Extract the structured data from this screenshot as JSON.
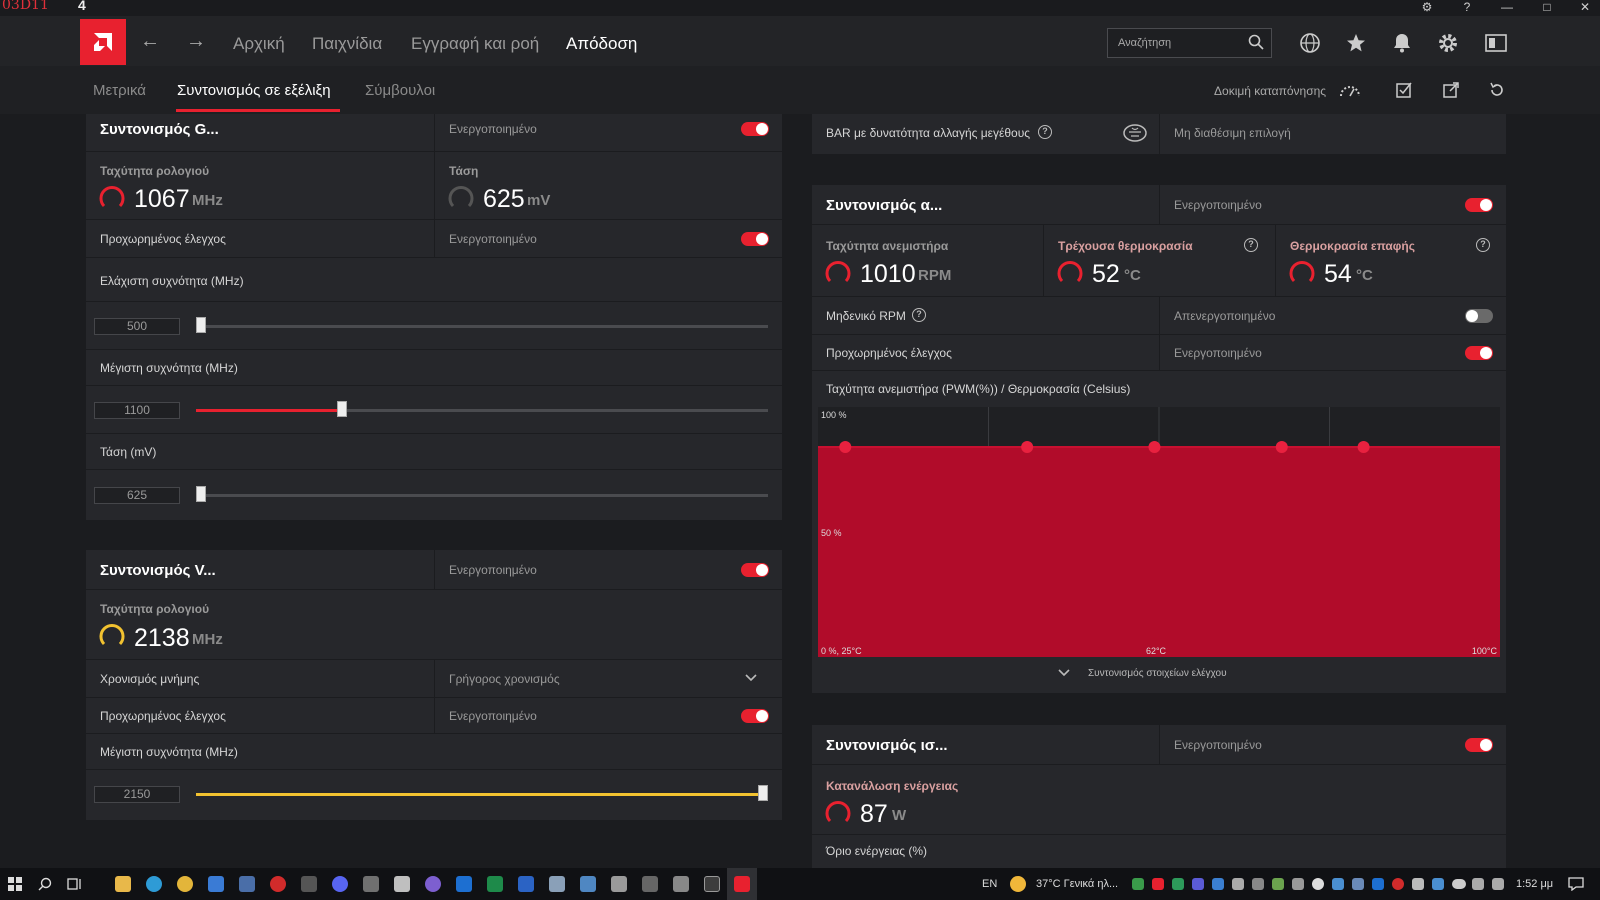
{
  "titlebar": {
    "left_text": "03D11",
    "left_text2": "4"
  },
  "nav": {
    "items": [
      "Αρχική",
      "Παιχνίδια",
      "Εγγραφή και ροή",
      "Απόδοση"
    ],
    "search_placeholder": "Αναζήτηση"
  },
  "subnav": {
    "items": [
      "Μετρικά",
      "Συντονισμός σε εξέλιξη",
      "Σύμβουλοι"
    ],
    "stress_test": "Δοκιμή καταπόνησης"
  },
  "gpu_panel": {
    "title": "Συντονισμός G...",
    "enabled": "Ενεργοποιημένο",
    "clock_label": "Ταχύτητα ρολογιού",
    "clock_value": "1067",
    "clock_unit": "MHz",
    "voltage_label": "Τάση",
    "voltage_value": "625",
    "voltage_unit": "mV",
    "advanced_label": "Προχωρημένος έλεγχος",
    "advanced_value": "Ενεργοποιημένο",
    "min_freq_label": "Ελάχιστη συχνότητα (MHz)",
    "min_freq_value": "500",
    "min_freq_level": 0.0,
    "max_freq_label": "Μέγιστη συχνότητα (MHz)",
    "max_freq_value": "1100",
    "max_freq_level": 0.25,
    "voltage_slider_label": "Τάση (mV)",
    "voltage_slider_value": "625",
    "voltage_level": 0.0
  },
  "vram_panel": {
    "title": "Συντονισμός V...",
    "enabled": "Ενεργοποιημένο",
    "clock_label": "Ταχύτητα ρολογιού",
    "clock_value": "2138",
    "clock_unit": "MHz",
    "timing_label": "Χρονισμός μνήμης",
    "timing_value": "Γρήγορος χρονισμός",
    "advanced_label": "Προχωρημένος έλεγχος",
    "advanced_value": "Ενεργοποιημένο",
    "max_freq_label": "Μέγιστη συχνότητα (MHz)",
    "max_freq_value": "2150",
    "max_freq_level": 1.0
  },
  "bar_panel": {
    "label": "BAR με δυνατότητα αλλαγής μεγέθους",
    "value": "Μη διαθέσιμη επιλογή"
  },
  "fan_panel": {
    "title": "Συντονισμός α...",
    "enabled": "Ενεργοποιημένο",
    "fan_speed_label": "Ταχύτητα ανεμιστήρα",
    "fan_speed_value": "1010",
    "fan_speed_unit": "RPM",
    "temp_label": "Τρέχουσα θερμοκρασία",
    "temp_value": "52",
    "temp_unit": "°C",
    "junction_label": "Θερμοκρασία επαφής",
    "junction_value": "54",
    "junction_unit": "°C",
    "zero_rpm_label": "Μηδενικό RPM",
    "zero_rpm_value": "Απενεργοποιημένο",
    "advanced_label": "Προχωρημένος έλεγχος",
    "advanced_value": "Ενεργοποιημένο",
    "curve_title": "Ταχύτητα ανεμιστήρα (PWM(%)) / Θερμοκρασία (Celsius)",
    "tune_controls": "Συντονισμός στοιχείων ελέγχου"
  },
  "chart_data": {
    "type": "area",
    "title": "Ταχύτητα ανεμιστήρα (PWM(%)) / Θερμοκρασία (Celsius)",
    "x": [
      28,
      48,
      62,
      76,
      85
    ],
    "y": [
      84,
      84,
      84,
      84,
      84
    ],
    "xlim": [
      25,
      100
    ],
    "ylim": [
      0,
      100
    ],
    "y_ticks": [
      "100 %",
      "50 %"
    ],
    "x_ticks": [
      "0 %, 25°C",
      "62°C",
      "100°C"
    ],
    "grid": true
  },
  "power_panel": {
    "title": "Συντονισμός ισ...",
    "enabled": "Ενεργοποιημένο",
    "consumption_label": "Κατανάλωση ενέργειας",
    "consumption_value": "87",
    "consumption_unit": "W",
    "limit_label": "Όριο ενέργειας (%)"
  },
  "taskbar": {
    "lang": "EN",
    "weather": "37°C  Γενικά ηλ...",
    "time": "1:52 μμ"
  },
  "colors": {
    "accent": "#e8212f",
    "vram": "#f2c230",
    "panel": "#26272b",
    "bg": "#1b1c1f"
  }
}
